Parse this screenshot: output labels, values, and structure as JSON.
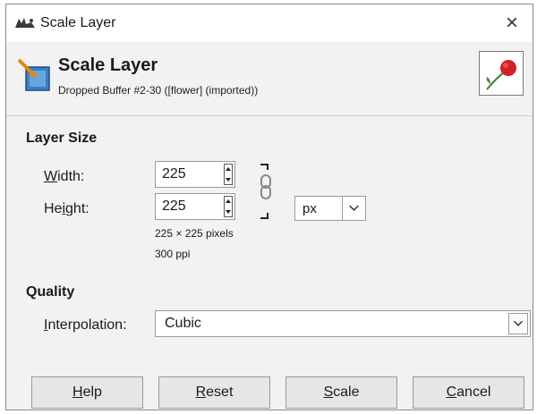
{
  "window": {
    "title": "Scale Layer",
    "close_glyph": "×",
    "app_icon": "gimp-wilber-icon"
  },
  "header": {
    "title": "Scale Layer",
    "subtitle": "Dropped Buffer #2-30 ([flower] (imported))",
    "icon": "scale-layer-icon",
    "preview_icon": "flower-thumbnail"
  },
  "layer_size": {
    "section_title": "Layer Size",
    "width_label_key": "W",
    "width_label_rest": "idth:",
    "height_label_pre": "He",
    "height_label_key": "i",
    "height_label_rest": "ght:",
    "width_value": "225",
    "height_value": "225",
    "unit": "px",
    "pixels_info": "225 × 225 pixels",
    "resolution_info": "300 ppi"
  },
  "quality": {
    "section_title": "Quality",
    "interpolation_label_key": "I",
    "interpolation_label_rest": "nterpolation:",
    "interpolation_value": "Cubic"
  },
  "buttons": {
    "help_key": "H",
    "help_rest": "elp",
    "reset_key": "R",
    "reset_rest": "eset",
    "scale_key": "S",
    "scale_rest": "cale",
    "cancel_key": "C",
    "cancel_rest": "ancel"
  },
  "colors": {
    "dialog_bg": "#f2f2f2",
    "button_bg": "#e6e6e6",
    "flower_red": "#d42020"
  }
}
